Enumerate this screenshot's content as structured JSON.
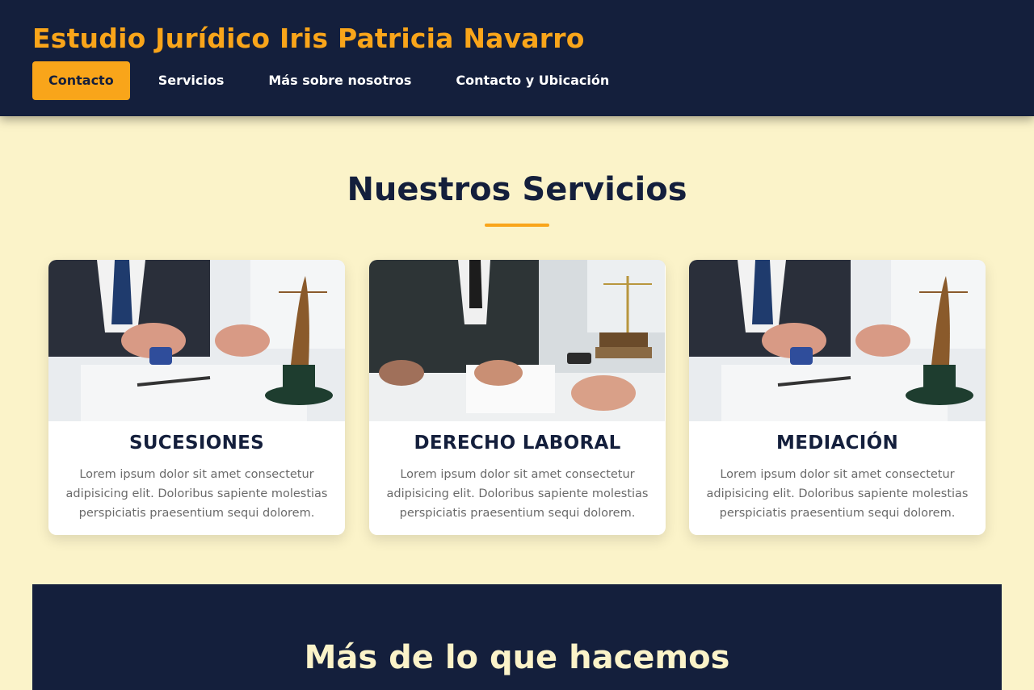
{
  "header": {
    "title": "Estudio Jurídico Iris Patricia Navarro",
    "nav": [
      {
        "label": "Contacto",
        "active": true
      },
      {
        "label": "Servicios",
        "active": false
      },
      {
        "label": "Más sobre nosotros",
        "active": false
      },
      {
        "label": "Contacto y Ubicación",
        "active": false
      }
    ]
  },
  "services": {
    "title": "Nuestros Servicios",
    "cards": [
      {
        "title": "SUCESIONES",
        "text": "Lorem ipsum dolor sit amet consectetur adipisicing elit. Doloribus sapiente molestias perspiciatis praesentium sequi dolorem.",
        "image": "lawyer-stamp-justice-statue-photo"
      },
      {
        "title": "DERECHO LABORAL",
        "text": "Lorem ipsum dolor sit amet consectetur adipisicing elit. Doloribus sapiente molestias perspiciatis praesentium sequi dolorem.",
        "image": "contract-signing-gavel-scales-photo"
      },
      {
        "title": "MEDIACIÓN",
        "text": "Lorem ipsum dolor sit amet consectetur adipisicing elit. Doloribus sapiente molestias perspiciatis praesentium sequi dolorem.",
        "image": "lawyer-stamp-justice-statue-photo"
      }
    ]
  },
  "more": {
    "title": "Más de lo que hacemos"
  },
  "colors": {
    "navy": "#141f3c",
    "accent": "#f9a51a",
    "cream": "#fbf3c9"
  }
}
